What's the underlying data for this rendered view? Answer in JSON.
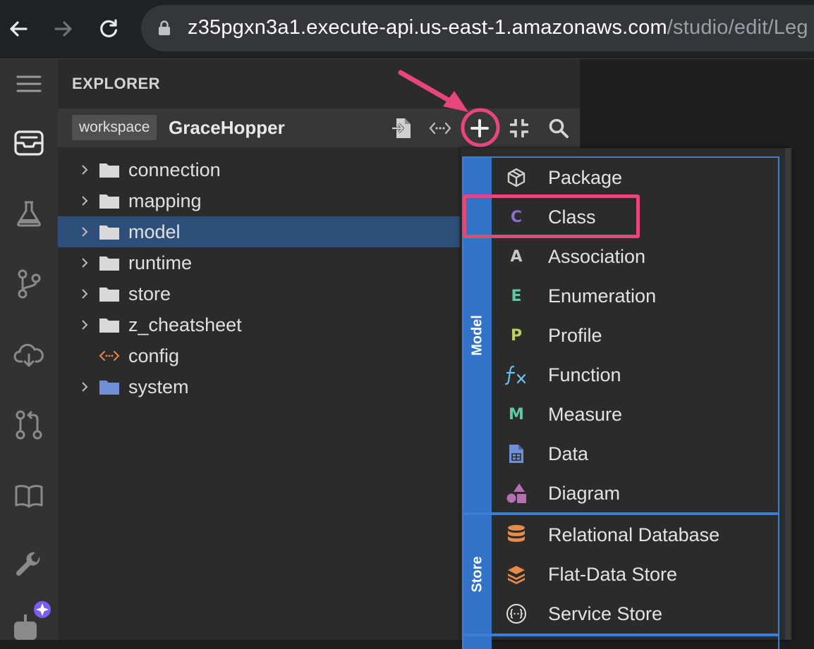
{
  "browser": {
    "url_host": "z35pgxn3a1.execute-api.us-east-1.amazonaws.com",
    "url_path": "/studio/edit/Leg"
  },
  "activity_bar": {
    "icons": [
      "menu-icon",
      "inbox-icon",
      "flask-icon",
      "source-branch-icon",
      "cloud-download-icon",
      "pull-request-icon",
      "book-icon",
      "wrench-icon",
      "robot-icon"
    ]
  },
  "explorer": {
    "title": "EXPLORER",
    "workspace_badge": "workspace",
    "workspace_name": "GraceHopper",
    "tree": [
      {
        "label": "connection",
        "kind": "folder"
      },
      {
        "label": "mapping",
        "kind": "folder"
      },
      {
        "label": "model",
        "kind": "folder",
        "selected": true
      },
      {
        "label": "runtime",
        "kind": "folder"
      },
      {
        "label": "store",
        "kind": "folder"
      },
      {
        "label": "z_cheatsheet",
        "kind": "folder"
      },
      {
        "label": "config",
        "kind": "file"
      },
      {
        "label": "system",
        "kind": "folder-blue"
      }
    ]
  },
  "menu": {
    "groups": [
      {
        "label": "Model",
        "items": [
          {
            "label": "Package",
            "icon": "package-icon"
          },
          {
            "label": "Class",
            "icon": "class-icon",
            "glyph": "C",
            "color": "#8e6cc9"
          },
          {
            "label": "Association",
            "icon": "association-icon",
            "glyph": "A",
            "color": "#c8c8c8"
          },
          {
            "label": "Enumeration",
            "icon": "enumeration-icon",
            "glyph": "E",
            "color": "#5fc9a5"
          },
          {
            "label": "Profile",
            "icon": "profile-icon",
            "glyph": "P",
            "color": "#b6d362"
          },
          {
            "label": "Function",
            "icon": "function-icon"
          },
          {
            "label": "Measure",
            "icon": "measure-icon",
            "glyph": "M",
            "color": "#5fc9a5"
          },
          {
            "label": "Data",
            "icon": "data-icon"
          },
          {
            "label": "Diagram",
            "icon": "diagram-icon"
          }
        ]
      },
      {
        "label": "Store",
        "items": [
          {
            "label": "Relational Database",
            "icon": "database-icon"
          },
          {
            "label": "Flat-Data Store",
            "icon": "layers-icon"
          },
          {
            "label": "Service Store",
            "icon": "service-store-icon"
          }
        ]
      }
    ]
  },
  "colors": {
    "annotation": "#e8457a",
    "selection": "#2e4f7a",
    "menu_accent": "#3273c7",
    "file_icon": "#e88a4a"
  }
}
